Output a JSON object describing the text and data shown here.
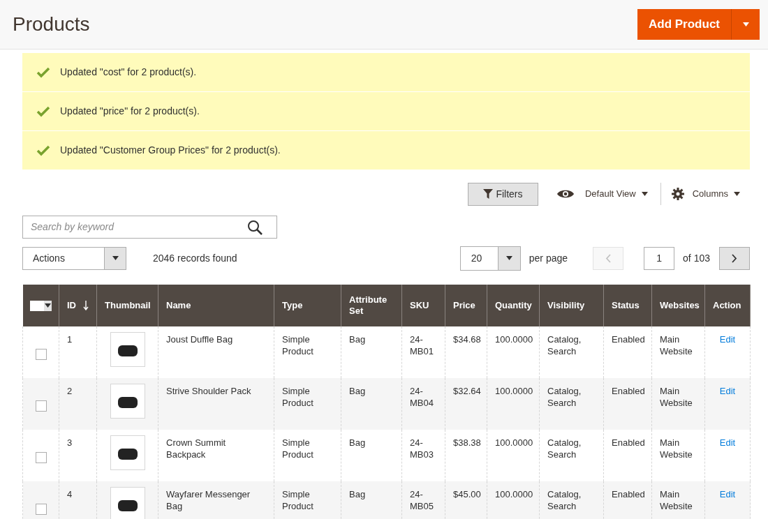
{
  "header": {
    "title": "Products",
    "add_button": "Add Product"
  },
  "messages": [
    {
      "text": "Updated \"cost\" for 2 product(s)."
    },
    {
      "text": "Updated \"price\" for 2 product(s)."
    },
    {
      "text": "Updated \"Customer Group Prices\" for 2 product(s)."
    }
  ],
  "toolbar": {
    "filters": "Filters",
    "view": "Default View",
    "columns": "Columns"
  },
  "search": {
    "placeholder": "Search by keyword"
  },
  "actions": {
    "value": "Actions"
  },
  "records": "2046 records found",
  "pager": {
    "per_page": "20",
    "per_page_label": "per page",
    "prev_disabled": true,
    "next_disabled": false,
    "page": "1",
    "of": "of 103"
  },
  "table": {
    "mass_select_checked": false,
    "columns": [
      {
        "label": "ID",
        "sorted": true
      },
      {
        "label": "Thumbnail",
        "sorted": false
      },
      {
        "label": "Name",
        "sorted": false
      },
      {
        "label": "Type",
        "sorted": false
      },
      {
        "label": "Attribute Set",
        "sorted": false
      },
      {
        "label": "SKU",
        "sorted": false
      },
      {
        "label": "Price",
        "sorted": false
      },
      {
        "label": "Quantity",
        "sorted": false
      },
      {
        "label": "Visibility",
        "sorted": false
      },
      {
        "label": "Status",
        "sorted": false
      },
      {
        "label": "Websites",
        "sorted": false
      },
      {
        "label": "Action",
        "sorted": false
      }
    ],
    "rows": [
      {
        "checked": false,
        "id": "1",
        "name": "Joust Duffle Bag",
        "type": "Simple Product",
        "attribute_set": "Bag",
        "sku": "24-MB01",
        "price": "$34.68",
        "quantity": "100.0000",
        "visibility": "Catalog, Search",
        "status": "Enabled",
        "websites": "Main Website",
        "action": "Edit"
      },
      {
        "checked": false,
        "id": "2",
        "name": "Strive Shoulder Pack",
        "type": "Simple Product",
        "attribute_set": "Bag",
        "sku": "24-MB04",
        "price": "$32.64",
        "quantity": "100.0000",
        "visibility": "Catalog, Search",
        "status": "Enabled",
        "websites": "Main Website",
        "action": "Edit"
      },
      {
        "checked": false,
        "id": "3",
        "name": "Crown Summit Backpack",
        "type": "Simple Product",
        "attribute_set": "Bag",
        "sku": "24-MB03",
        "price": "$38.38",
        "quantity": "100.0000",
        "visibility": "Catalog, Search",
        "status": "Enabled",
        "websites": "Main Website",
        "action": "Edit"
      },
      {
        "checked": false,
        "id": "4",
        "name": "Wayfarer Messenger Bag",
        "type": "Simple Product",
        "attribute_set": "Bag",
        "sku": "24-MB05",
        "price": "$45.00",
        "quantity": "100.0000",
        "visibility": "Catalog, Search",
        "status": "Enabled",
        "websites": "Main Website",
        "action": "Edit"
      }
    ]
  }
}
